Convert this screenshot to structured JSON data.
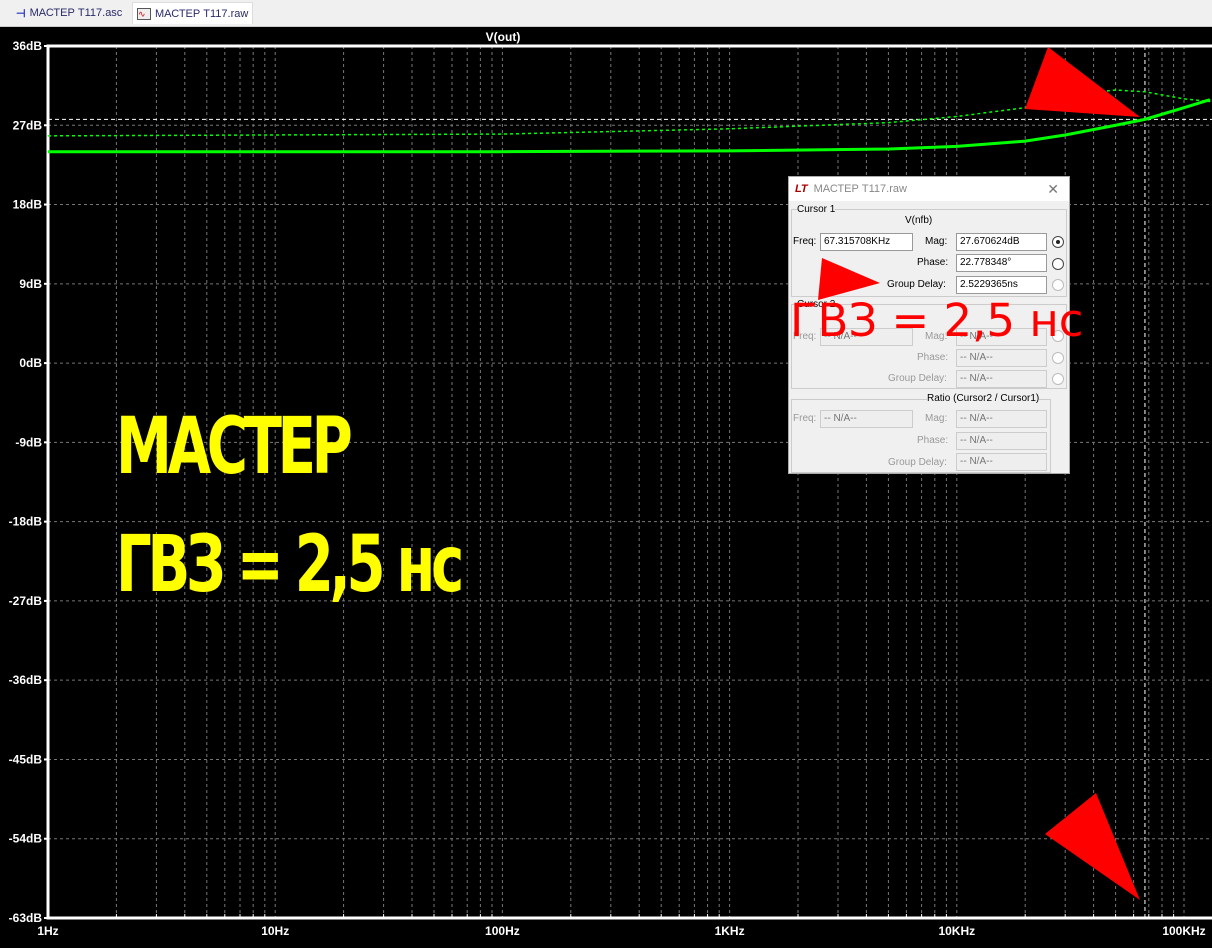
{
  "tabs": [
    {
      "label": "МАСТЕР Т117.asc",
      "icon": "schematic-transistor-icon"
    },
    {
      "label": "МАСТЕР Т117.raw",
      "icon": "waveform-icon",
      "active": true
    }
  ],
  "chart_data": {
    "type": "line",
    "title": "V(out)",
    "x_scale": "log",
    "xlim": [
      1,
      130000
    ],
    "ylim": [
      -63,
      36
    ],
    "x_ticks": [
      "1Hz",
      "10Hz",
      "100Hz",
      "1KHz",
      "10KHz",
      "100KHz"
    ],
    "x_tick_values": [
      1,
      10,
      100,
      1000,
      10000,
      100000
    ],
    "y_ticks": [
      "36dB",
      "27dB",
      "18dB",
      "9dB",
      "0dB",
      "-9dB",
      "-18dB",
      "-27dB",
      "-36dB",
      "-45dB",
      "-54dB",
      "-63dB"
    ],
    "y_tick_values": [
      36,
      27,
      18,
      9,
      0,
      -9,
      -18,
      -27,
      -36,
      -45,
      -54,
      -63
    ],
    "grid": true,
    "series": [
      {
        "style": "solid",
        "color": "#00ff00",
        "x": [
          1,
          100,
          1000,
          5000,
          10000,
          20000,
          30000,
          50000,
          67316,
          100000,
          130000
        ],
        "y": [
          24,
          24,
          24.1,
          24.3,
          24.6,
          25.2,
          25.9,
          27,
          27.67,
          29,
          29.9
        ]
      },
      {
        "style": "dotted",
        "color": "#00ff00",
        "x": [
          1,
          100,
          1000,
          5000,
          10000,
          20000,
          30000,
          50000,
          67316,
          100000,
          130000
        ],
        "y": [
          25.8,
          26,
          26.6,
          27.3,
          28,
          29,
          30.4,
          31,
          30.8,
          30,
          29.7
        ]
      }
    ],
    "cursor": {
      "freq": 67315.708,
      "mag": 27.670624
    }
  },
  "dialog": {
    "title": "МАСТЕР Т117.raw",
    "cursor1": {
      "label": "Cursor 1",
      "trace": "V(nfb)",
      "freq_label": "Freq:",
      "freq": "67.315708KHz",
      "mag_label": "Mag:",
      "mag": "27.670624dB",
      "phase_label": "Phase:",
      "phase": "22.778348°",
      "gd_label": "Group Delay:",
      "gd": "2.5229365ns"
    },
    "cursor2": {
      "label": "Cursor 2",
      "freq_label": "Freq:",
      "freq": "-- N/A--",
      "mag_label": "Mag:",
      "mag": "-- N/A--",
      "phase_label": "Phase:",
      "phase": "-- N/A--",
      "gd_label": "Group Delay:",
      "gd": "-- N/A--"
    },
    "ratio": {
      "label": "Ratio (Cursor2 / Cursor1)",
      "freq_label": "Freq:",
      "freq": "-- N/A--",
      "mag_label": "Mag:",
      "mag": "-- N/A--",
      "phase_label": "Phase:",
      "phase": "-- N/A--",
      "gd_label": "Group Delay:",
      "gd": "-- N/A--"
    }
  },
  "overlay": {
    "line1": "МАСТЕР",
    "line2": "ГВЗ = 2,5 нс",
    "red": "ГВЗ = 2,5 нс",
    "arrow_color": "#ff0000",
    "text_color": "#ffff00"
  }
}
